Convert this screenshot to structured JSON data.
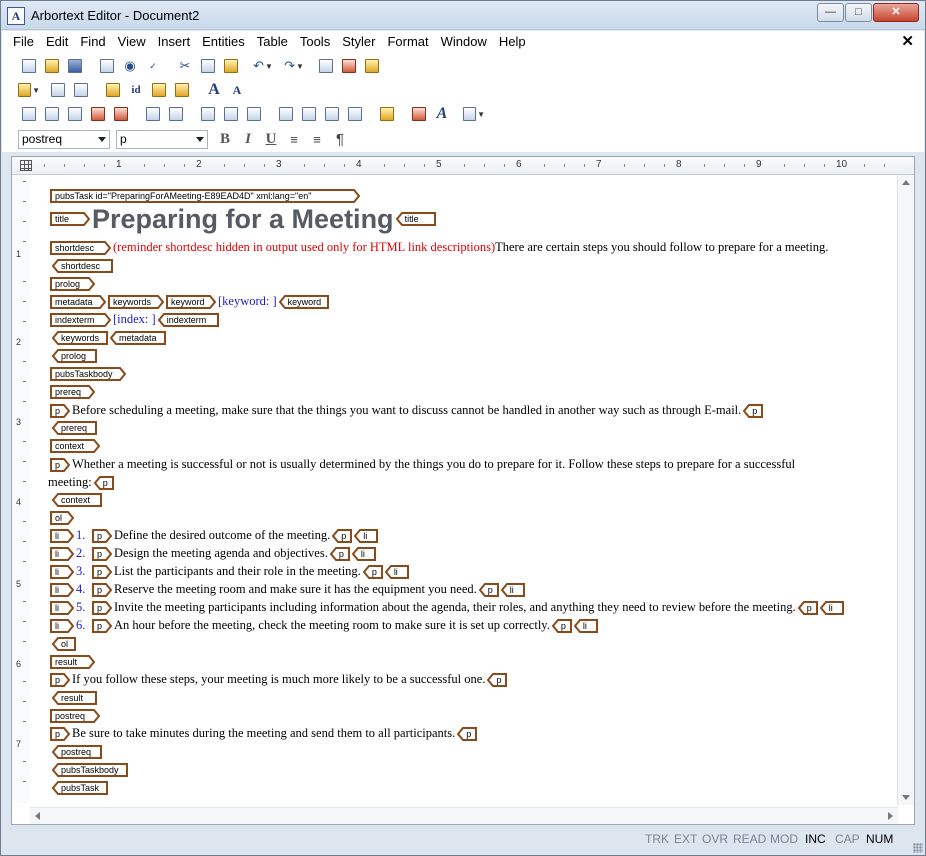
{
  "window": {
    "title": "Arbortext Editor - Document2",
    "icon": "arbortext-app-icon"
  },
  "menu": [
    "File",
    "Edit",
    "Find",
    "View",
    "Insert",
    "Entities",
    "Table",
    "Tools",
    "Styler",
    "Format",
    "Window",
    "Help"
  ],
  "toolbar": {
    "element_select": "postreq",
    "style_select": "p",
    "bold_label": "B",
    "italic_label": "I",
    "underline_label": "U",
    "pilcrow_label": "¶"
  },
  "ruler": {
    "numbers": [
      "1",
      "2",
      "3",
      "4",
      "5",
      "6",
      "7",
      "8",
      "9",
      "10"
    ],
    "vnumbers": [
      "1",
      "2",
      "3",
      "4",
      "5",
      "6",
      "7"
    ]
  },
  "document": {
    "pubsTask_start": "pubsTask id=\"PreparingForAMeeting-E89EAD4D\" xml:lang=\"en\"",
    "title_tag": "title",
    "title_text": "Preparing for a Meeting",
    "shortdesc_tag": "shortdesc",
    "shortdesc_note": "(reminder shortdesc hidden in output used only for HTML link descriptions)",
    "shortdesc_text": "There are certain steps you should follow to prepare for a meeting.",
    "prolog_tag": "prolog",
    "metadata_tag": "metadata",
    "keywords_tag": "keywords",
    "keyword_tag": "keyword",
    "keyword_text": "[keyword: ]",
    "indexterm_tag": "indexterm",
    "index_text": "[index: ]",
    "pubsTaskbody_tag": "pubsTaskbody",
    "prereq_tag": "prereq",
    "p_tag": "p",
    "prereq_text": "Before scheduling a meeting, make sure that the things you want to discuss cannot be handled in another way such as through E-mail.",
    "context_tag": "context",
    "context_text_1": "Whether a meeting is successful or not is usually determined by the things you do to prepare for it. Follow these steps to prepare for a successful",
    "context_text_2": "meeting:",
    "ol_tag": "ol",
    "li_tag": "li",
    "steps": [
      {
        "num": "1.",
        "text": "Define the desired outcome of the meeting."
      },
      {
        "num": "2.",
        "text": "Design the meeting agenda and objectives."
      },
      {
        "num": "3.",
        "text": "List the participants and their role in the meeting."
      },
      {
        "num": "4.",
        "text": "Reserve the meeting room and make sure it has the equipment you need."
      },
      {
        "num": "5.",
        "text": "Invite the meeting participants including information about the agenda, their roles, and anything they need to review before the meeting."
      },
      {
        "num": "6.",
        "text": "An hour before the meeting, check the meeting room to make sure it is set up correctly."
      }
    ],
    "result_tag": "result",
    "result_text": "If you follow these steps, your meeting is much more likely to be a successful one.",
    "postreq_tag": "postreq",
    "postreq_text": "Be sure to take minutes during the meeting and send them to all participants.",
    "pubsTask_end": "pubsTask"
  },
  "status": [
    "TRK",
    "EXT",
    "OVR",
    "READ",
    "MOD",
    "INC",
    "CAP",
    "NUM"
  ],
  "status_active": [
    "INC",
    "NUM"
  ],
  "colors": {
    "tag_border": "#8a4a1a",
    "shortdesc_red": "#e00000",
    "link_blue": "#1a1ad0",
    "title_gray": "#555a63"
  }
}
